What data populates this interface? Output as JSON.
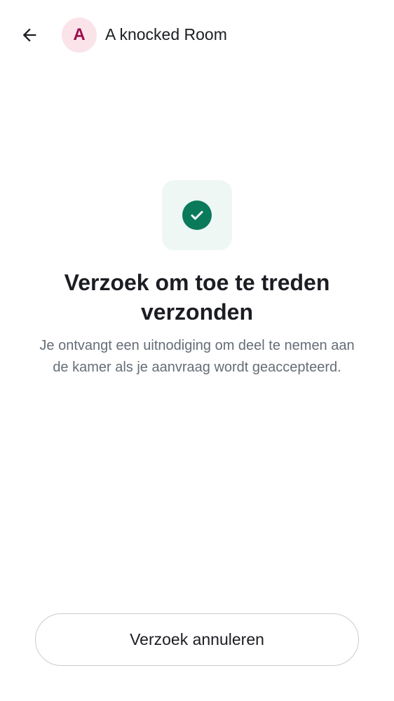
{
  "header": {
    "back_icon": "arrow-left-icon",
    "avatar_letter": "A",
    "room_name": "A knocked Room"
  },
  "status": {
    "icon": "check-circle-icon",
    "title": "Verzoek om toe te treden verzonden",
    "description": "Je ontvangt een uitnodiging om deel te nemen aan de kamer als je aanvraag wordt geaccepteerd."
  },
  "actions": {
    "cancel_label": "Verzoek annuleren"
  },
  "colors": {
    "accent_green": "#0a7a5a",
    "tile_background": "#eef7f3",
    "avatar_background": "#fbe3ea",
    "avatar_letter": "#9b0f4d"
  }
}
